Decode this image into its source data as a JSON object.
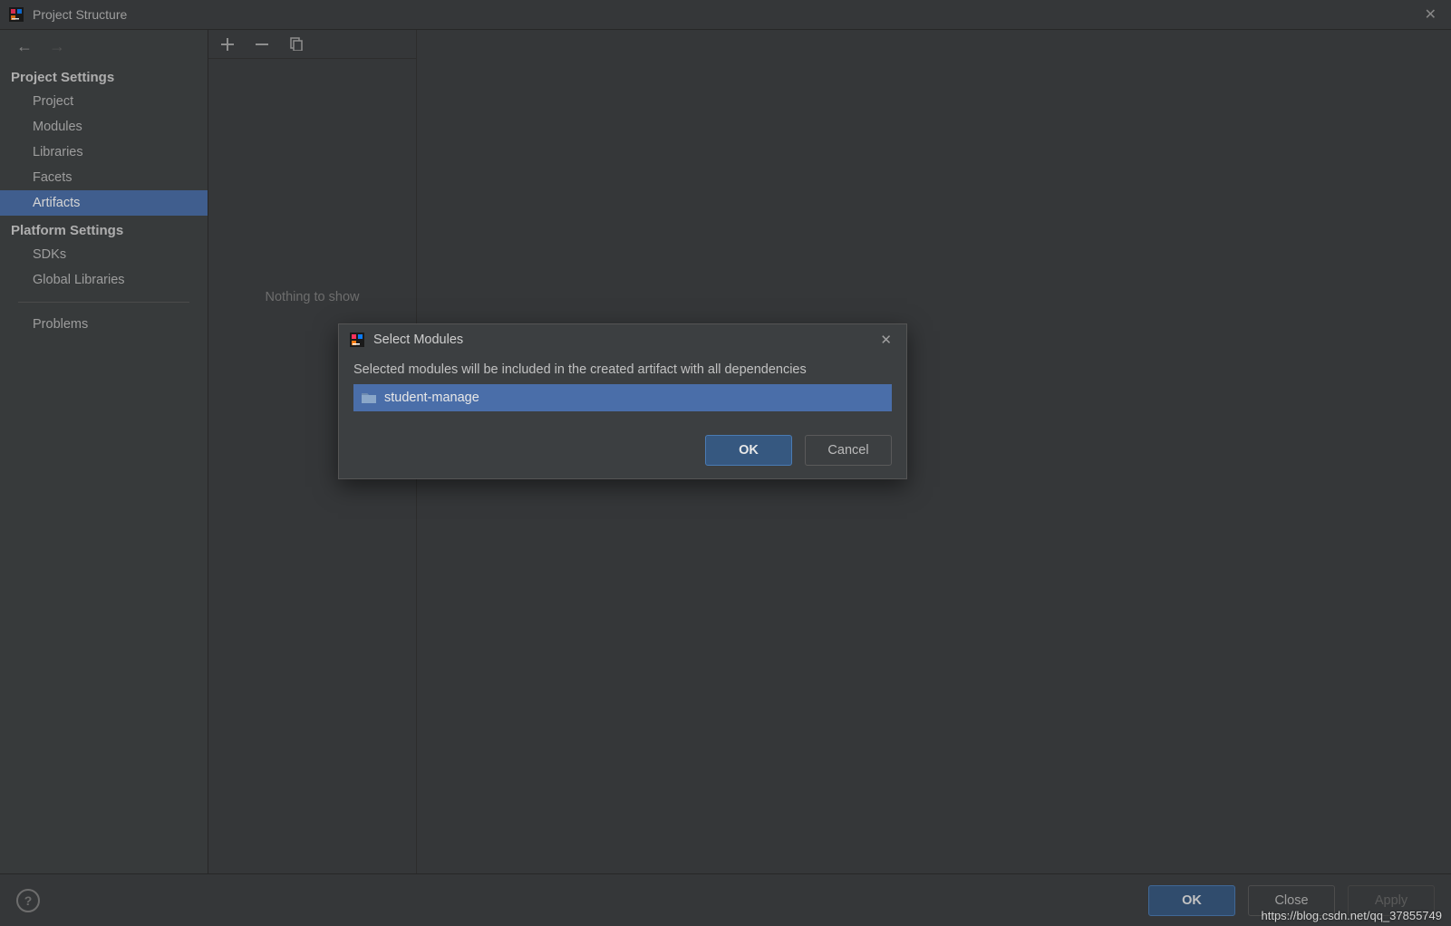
{
  "window": {
    "title": "Project Structure"
  },
  "sidebar": {
    "sections": {
      "project_settings": {
        "title": "Project Settings",
        "items": [
          "Project",
          "Modules",
          "Libraries",
          "Facets",
          "Artifacts"
        ]
      },
      "platform_settings": {
        "title": "Platform Settings",
        "items": [
          "SDKs",
          "Global Libraries"
        ]
      },
      "problems": {
        "items": [
          "Problems"
        ]
      }
    }
  },
  "middle": {
    "placeholder": "Nothing to show"
  },
  "footer": {
    "ok": "OK",
    "close": "Close",
    "apply": "Apply"
  },
  "modal": {
    "title": "Select Modules",
    "message": "Selected modules will be included in the created artifact with all dependencies",
    "items": [
      "student-manage"
    ],
    "ok": "OK",
    "cancel": "Cancel"
  },
  "watermark": "https://blog.csdn.net/qq_37855749"
}
